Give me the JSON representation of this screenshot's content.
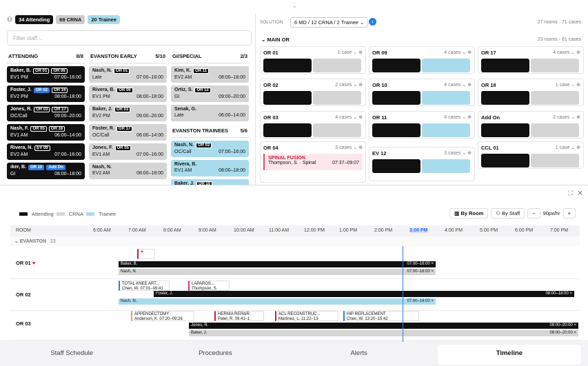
{
  "chips": {
    "attending": "34 Attending",
    "crna": "69 CRNA",
    "trainee": "20 Trainee"
  },
  "filter_placeholder": "Filter staff...",
  "cols": [
    {
      "title": "ATTENDING",
      "count": "8/8"
    },
    {
      "title": "EVANSTON EARLY",
      "count": "5/10"
    },
    {
      "title": "GI/SPECIAL",
      "count": "2/3"
    }
  ],
  "solution": {
    "label": "SOLUTION",
    "value": "6 MD / 12 CRNA / 2 Trainee",
    "rooms": "27 rooms · 71 cases",
    "main_or": "MAIN OR",
    "main_count": "23 rooms · 61 cases"
  },
  "ors": [
    {
      "name": "OR 01",
      "cases": "1 case"
    },
    {
      "name": "OR 09",
      "cases": "4 cases"
    },
    {
      "name": "OR 17",
      "cases": "4 cases"
    },
    {
      "name": "OR 02",
      "cases": "2 cases"
    },
    {
      "name": "OR 10",
      "cases": "4 cases"
    },
    {
      "name": "OR 18",
      "cases": "1 case"
    },
    {
      "name": "OR 03",
      "cases": "4 cases"
    },
    {
      "name": "OR 11",
      "cases": "4 cases"
    },
    {
      "name": "Add On",
      "cases": "2 cases"
    },
    {
      "name": "OR 04",
      "cases": "3 cases"
    },
    {
      "name": "EV 12",
      "cases": "3 cases"
    },
    {
      "name": "CCL 01",
      "cases": "1 case"
    }
  ],
  "spinal": {
    "name": "SPINAL FUSION",
    "who": "Thompson, S.",
    "type": "Spinal",
    "time": "07:37–09:07"
  },
  "legend": {
    "a": "Attending",
    "c": "CRNA",
    "t": "Trainee"
  },
  "view": {
    "room": "By Room",
    "staff": "By Staff",
    "zoom": "90px/hr"
  },
  "hours": [
    "6:00 AM",
    "7:00 AM",
    "8:00 AM",
    "9:00 AM",
    "10:00 AM",
    "11:00 AM",
    "12:00 PM",
    "1:00 PM",
    "2:00 PM",
    "3:00 PM",
    "4:00 PM",
    "5:00 PM",
    "6:00 PM",
    "7:00 PM"
  ],
  "room_h": "ROOM",
  "group": "EVANSTON",
  "group_n": "23",
  "rows": [
    "OR 01",
    "OR 02",
    "OR 03"
  ],
  "tabs": [
    "Staff Schedule",
    "Procedures",
    "Alerts",
    "Timeline"
  ]
}
